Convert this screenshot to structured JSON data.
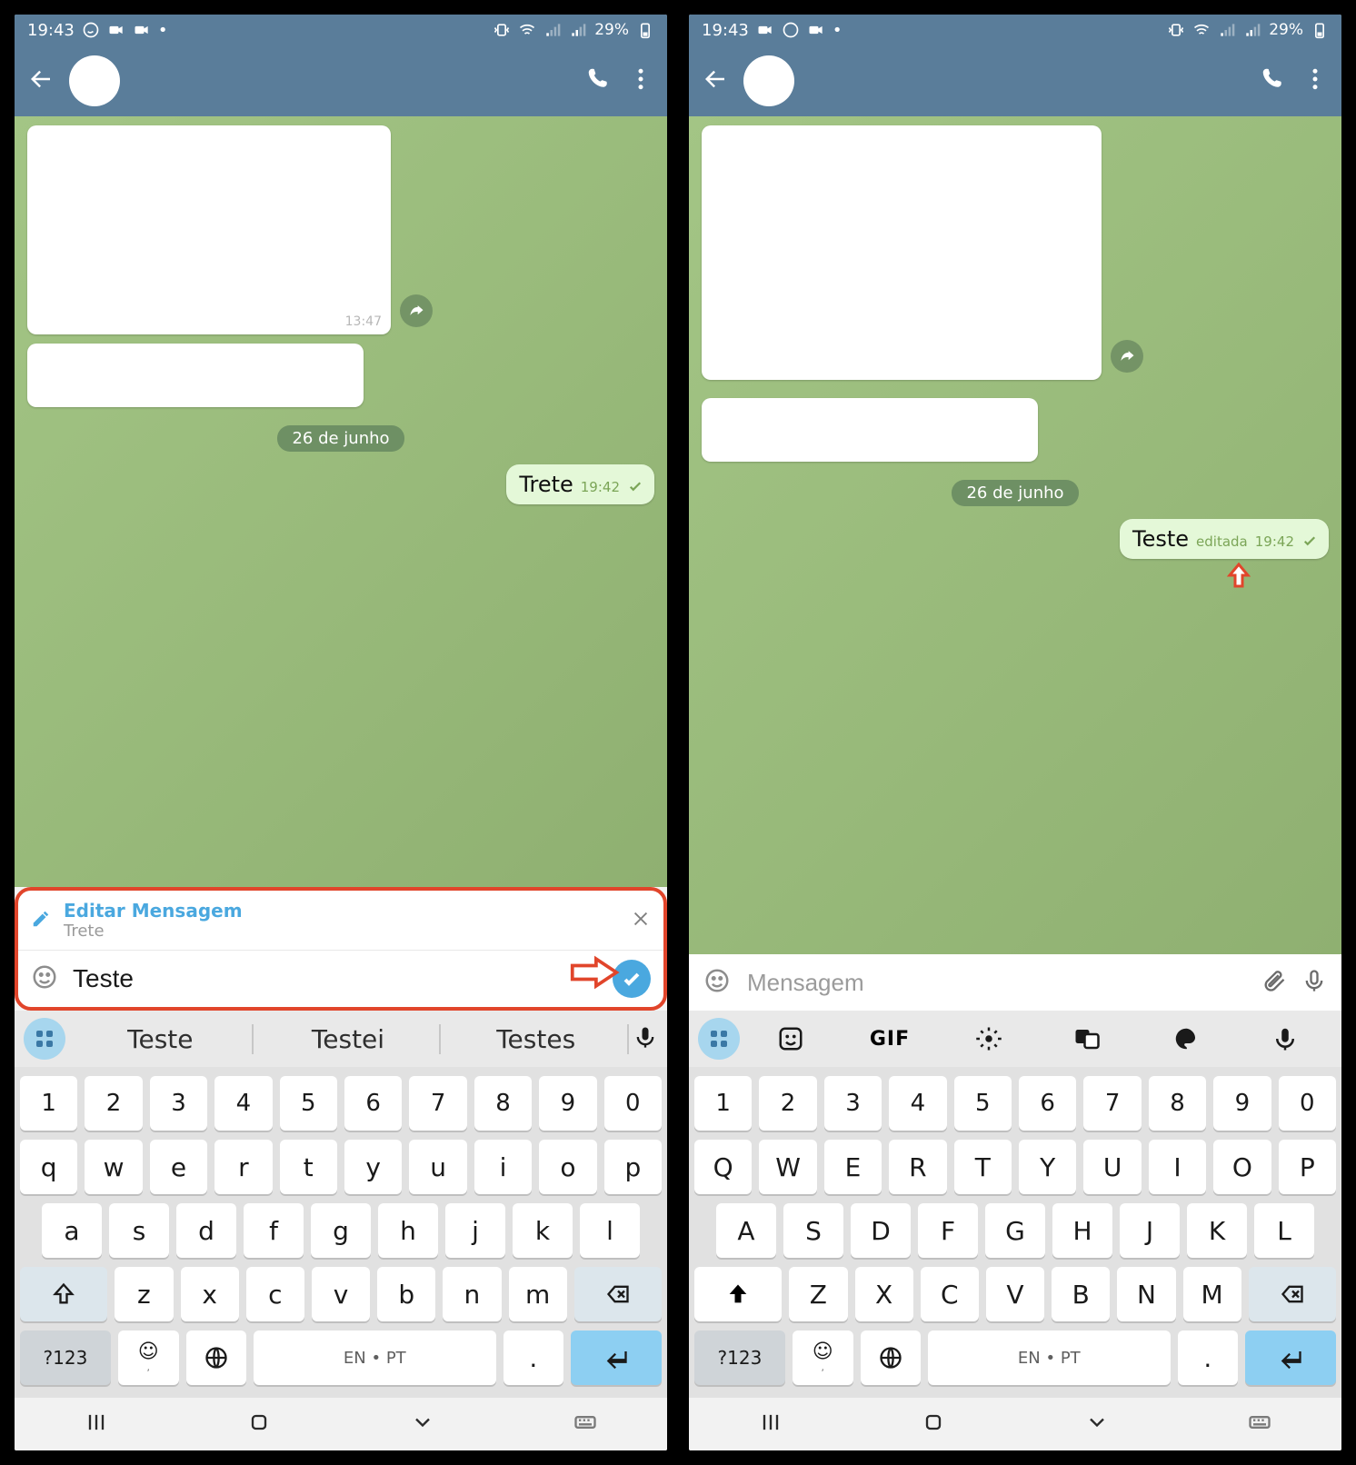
{
  "status": {
    "time": "19:43",
    "battery": "29%"
  },
  "chat": {
    "date_label": "26 de junho",
    "received_time": "13:47"
  },
  "phoneA": {
    "sent_message": "Trete",
    "sent_time": "19:42",
    "edit_title": "Editar Mensagem",
    "edit_preview": "Trete",
    "input_value": "Teste",
    "suggestions": [
      "Teste",
      "Testei",
      "Testes"
    ],
    "keyboard_rows": [
      [
        "1",
        "2",
        "3",
        "4",
        "5",
        "6",
        "7",
        "8",
        "9",
        "0"
      ],
      [
        "q",
        "w",
        "e",
        "r",
        "t",
        "y",
        "u",
        "i",
        "o",
        "p"
      ],
      [
        "a",
        "s",
        "d",
        "f",
        "g",
        "h",
        "j",
        "k",
        "l"
      ],
      [
        "z",
        "x",
        "c",
        "v",
        "b",
        "n",
        "m"
      ]
    ],
    "sym_key": "?123",
    "lang_label": "EN • PT",
    "period": "."
  },
  "phoneB": {
    "sent_message": "Teste",
    "edited_label": "editada",
    "sent_time": "19:42",
    "input_placeholder": "Mensagem",
    "toolbar_gif": "GIF",
    "keyboard_rows": [
      [
        "1",
        "2",
        "3",
        "4",
        "5",
        "6",
        "7",
        "8",
        "9",
        "0"
      ],
      [
        "Q",
        "W",
        "E",
        "R",
        "T",
        "Y",
        "U",
        "I",
        "O",
        "P"
      ],
      [
        "A",
        "S",
        "D",
        "F",
        "G",
        "H",
        "J",
        "K",
        "L"
      ],
      [
        "Z",
        "X",
        "C",
        "V",
        "B",
        "N",
        "M"
      ]
    ],
    "sym_key": "?123",
    "lang_label": "EN • PT",
    "period": "."
  }
}
